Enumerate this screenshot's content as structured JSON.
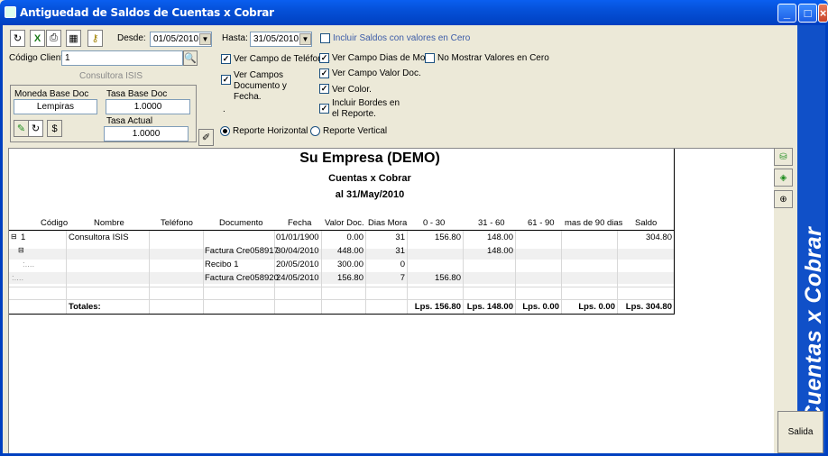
{
  "window": {
    "title": "Antiguedad de Saldos de Cuentas x Cobrar"
  },
  "filters": {
    "desde_label": "Desde:",
    "desde_value": "01/05/2010",
    "hasta_label": "Hasta:",
    "hasta_value": "31/05/2010",
    "incluir_ceros": "Incluir Saldos con valores en Cero",
    "codigo_label": "Código Cliente:",
    "codigo_value": "1",
    "cliente_name": "Consultora ISIS"
  },
  "moneda": {
    "base_label": "Moneda Base Doc",
    "base_value": "Lempiras",
    "tasa_base_label": "Tasa Base Doc",
    "tasa_base_value": "1.0000",
    "tasa_actual_label": "Tasa Actual",
    "tasa_actual_value": "1.0000"
  },
  "options": {
    "ver_telefono": "Ver Campo de Teléfono.",
    "ver_doc_fecha": "Ver Campos Documento y Fecha.",
    "ver_dias_mora": "Ver Campo Dias de Mora",
    "ver_valor_doc": "Ver Campo Valor Doc.",
    "ver_color": "Ver Color.",
    "incluir_bordes": "Incluir Bordes en el Reporte.",
    "no_mostrar_ceros": "No Mostrar Valores en Cero",
    "reporte_horizontal": "Reporte Horizontal",
    "reporte_vertical": "Reporte Vertical",
    "dot": "."
  },
  "report": {
    "company": "Su Empresa  (DEMO)",
    "subtitle": "Cuentas x Cobrar",
    "date": "al 31/May/2010",
    "headers": [
      "Código",
      "Nombre",
      "Teléfono",
      "Documento",
      "Fecha",
      "Valor Doc.",
      "Dias Mora",
      "0 - 30",
      "31 - 60",
      "61 - 90",
      "mas de 90 dias",
      "Saldo"
    ],
    "client_row": {
      "codigo": "1",
      "nombre": "Consultora ISIS",
      "fecha": "01/01/1900",
      "valor": "0.00",
      "dias": "31",
      "c0_30": "156.80",
      "c31_60": "148.00",
      "saldo": "304.80"
    },
    "doc_rows": [
      {
        "documento": "Factura Cre058917",
        "fecha": "30/04/2010",
        "valor": "448.00",
        "dias": "31",
        "c0_30": "",
        "c31_60": "148.00"
      },
      {
        "documento": "Recibo 1",
        "fecha": "20/05/2010",
        "valor": "300.00",
        "dias": "0",
        "c0_30": "",
        "c31_60": ""
      },
      {
        "documento": "Factura Cre058920",
        "fecha": "24/05/2010",
        "valor": "156.80",
        "dias": "7",
        "c0_30": "156.80",
        "c31_60": ""
      }
    ],
    "totals": {
      "label": "Totales:",
      "c0_30": "Lps. 156.80",
      "c31_60": "Lps. 148.00",
      "c61_90": "Lps. 0.00",
      "c90": "Lps. 0.00",
      "saldo": "Lps. 304.80"
    }
  },
  "sidebar": {
    "vertical_title": "Cuentas x Cobrar",
    "salida": "Salida"
  },
  "colors": {
    "titlebar": "#0550d8",
    "sidebar": "#1050c8",
    "row_alt": "#f0f0f0"
  }
}
